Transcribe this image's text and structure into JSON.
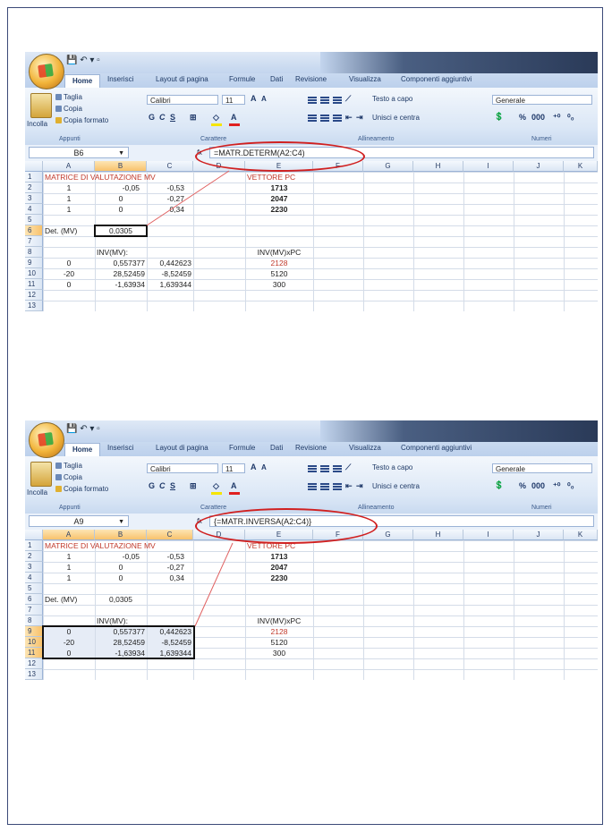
{
  "ribbon": {
    "tabs": [
      "Home",
      "Inserisci",
      "Layout di pagina",
      "Formule",
      "Dati",
      "Revisione",
      "Visualizza",
      "Componenti aggiuntivi"
    ],
    "clipboard": {
      "paste": "Incolla",
      "cut": "Taglia",
      "copy": "Copia",
      "format_painter": "Copia formato",
      "group": "Appunti"
    },
    "font": {
      "name": "Calibri",
      "size": "11",
      "group": "Carattere"
    },
    "alignment": {
      "wrap": "Testo a capo",
      "merge": "Unisci e centra",
      "group": "Allineamento"
    },
    "number": {
      "format": "Generale",
      "group": "Numeri"
    }
  },
  "columns": [
    "A",
    "B",
    "C",
    "D",
    "E",
    "F",
    "G",
    "H",
    "I",
    "J",
    "K"
  ],
  "rows": [
    "1",
    "2",
    "3",
    "4",
    "5",
    "6",
    "7",
    "8",
    "9",
    "10",
    "11",
    "12",
    "13"
  ],
  "sheet": {
    "title_a": "MATRICE DI VALUTAZIONE MV",
    "title_e": "VETTORE PC",
    "mv": [
      [
        "1",
        "-0,05",
        "-0,53"
      ],
      [
        "1",
        "0",
        "-0,27"
      ],
      [
        "1",
        "0",
        "0,34"
      ]
    ],
    "pc": [
      "1713",
      "2047",
      "2230"
    ],
    "det_label": "Det. (MV)",
    "det_value": "0,0305",
    "inv_label": "INV(MV):",
    "invpc_label": "INV(MV)xPC",
    "inv": [
      [
        "0",
        "0,557377",
        "0,442623"
      ],
      [
        "-20",
        "28,52459",
        "-8,52459"
      ],
      [
        "0",
        "-1,63934",
        "1,639344"
      ]
    ],
    "invpc": [
      "2128",
      "5120",
      "300"
    ]
  },
  "screenshots": [
    {
      "name_box": "B6",
      "formula": "=MATR.DETERM(A2:C4)"
    },
    {
      "name_box": "A9",
      "formula": "{=MATR.INVERSA(A2:C4)}"
    }
  ]
}
